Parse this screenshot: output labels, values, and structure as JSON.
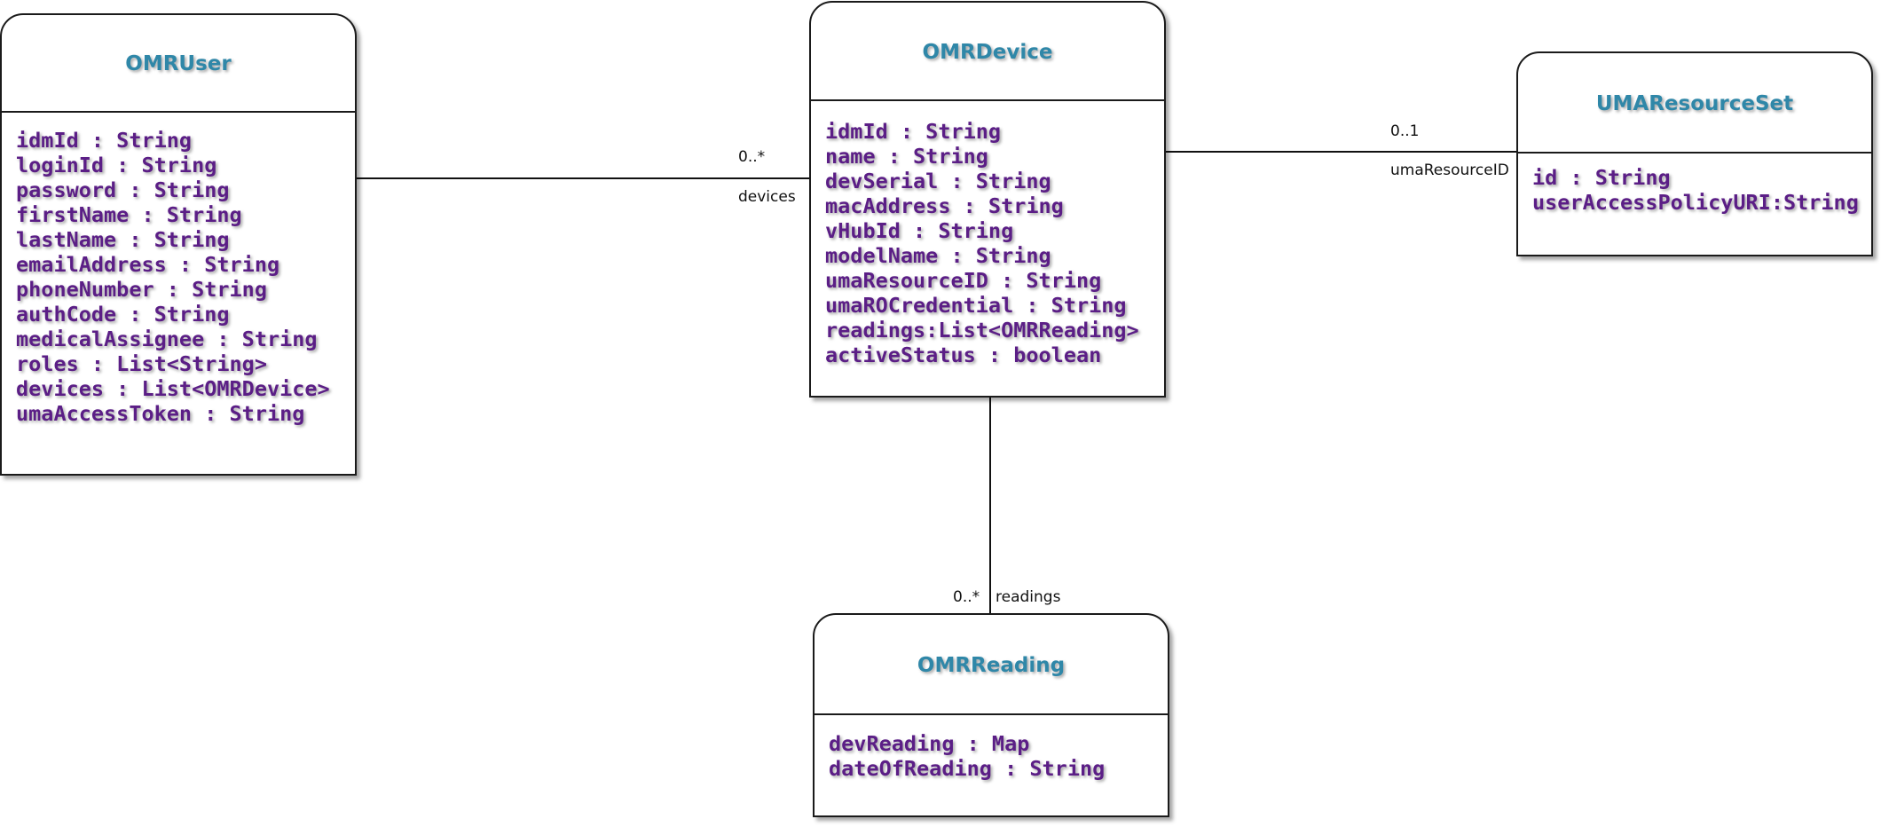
{
  "classes": {
    "omr_user": {
      "name": "OMRUser",
      "attributes": [
        "idmId : String",
        "loginId : String",
        "password : String",
        "firstName : String",
        "lastName : String",
        "emailAddress : String",
        "phoneNumber : String",
        "authCode : String",
        "medicalAssignee : String",
        "roles : List<String>",
        "devices : List<OMRDevice>",
        "umaAccessToken : String"
      ]
    },
    "omr_device": {
      "name": "OMRDevice",
      "attributes": [
        "idmId : String",
        "name : String",
        "devSerial : String",
        "macAddress : String",
        "vHubId : String",
        "modelName : String",
        "umaResourceID : String",
        "umaROCredential : String",
        "readings:List<OMRReading>",
        "activeStatus : boolean"
      ]
    },
    "uma_resource_set": {
      "name": "UMAResourceSet",
      "attributes": [
        "id : String",
        "userAccessPolicyURI:String"
      ]
    },
    "omr_reading": {
      "name": "OMRReading",
      "attributes": [
        "devReading : Map",
        "dateOfReading : String"
      ]
    }
  },
  "associations": {
    "user_devices": {
      "multiplicity": "0..*",
      "role": "devices"
    },
    "device_resource": {
      "multiplicity": "0..1",
      "role": "umaResourceID"
    },
    "device_readings": {
      "multiplicity": "0..*",
      "role": "readings"
    }
  }
}
